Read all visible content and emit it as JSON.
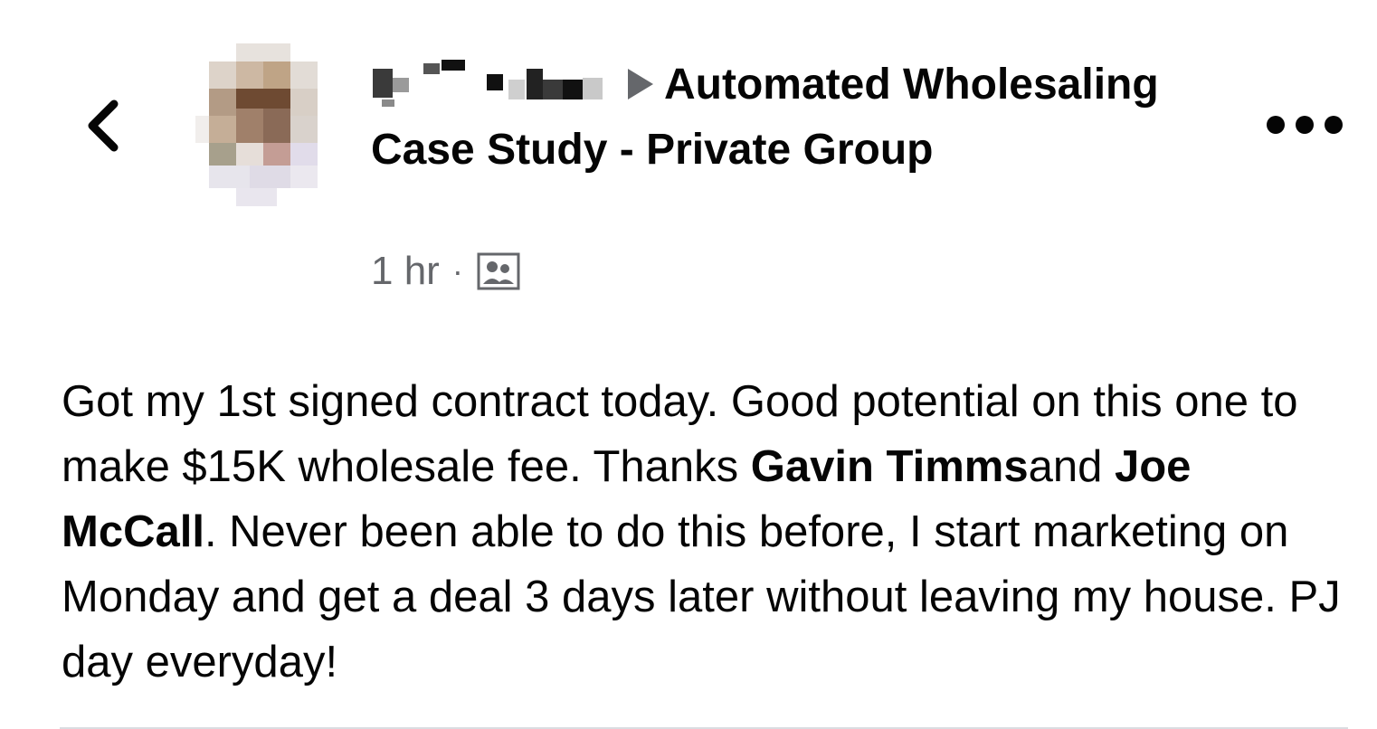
{
  "post": {
    "author_name_redacted": true,
    "group_name": "Automated Wholesaling Case Study - Private Group",
    "timestamp": "1 hr",
    "separator": "·",
    "privacy_icon": "group-members-icon",
    "body": {
      "seg1": "Got my 1st signed contract today. Good potential on this one to make $15K wholesale fee. Thanks ",
      "mention1": "Gavin Timms",
      "seg2": "and ",
      "mention2": "Joe McCall",
      "seg3": ". Never been able to do this before, I start marketing on Monday and get a deal 3 days later without leaving my house. PJ day everyday!"
    }
  },
  "icons": {
    "back": "chevron-left-icon",
    "more": "more-horizontal-icon"
  },
  "colors": {
    "text_primary": "#050505",
    "text_secondary": "#65676b",
    "divider": "#dadde1"
  }
}
